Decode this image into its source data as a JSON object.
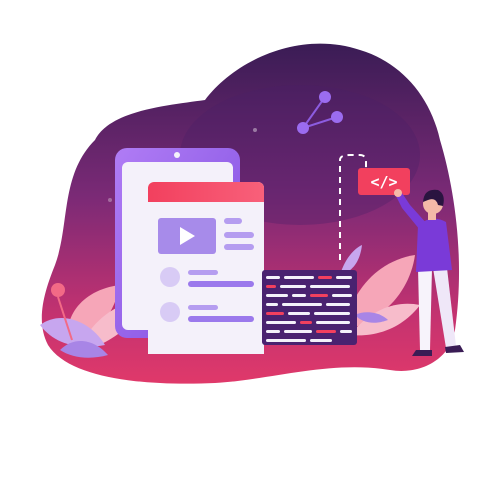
{
  "code_badge": {
    "text": "</>"
  },
  "icons": {
    "share": "share-icon",
    "play": "play-icon"
  },
  "colors": {
    "blob_dark": "#3a1c55",
    "blob_mid": "#8a2a78",
    "blob_light": "#e0396a",
    "accent_pink": "#f2405e",
    "accent_purple": "#8c5ce0",
    "device_body": "#a46cf0",
    "card_bg": "#f4f1fa",
    "person_shirt": "#7a3ad8",
    "leaf_pink": "#f6a6b8",
    "leaf_purple": "#c7a6ef"
  }
}
